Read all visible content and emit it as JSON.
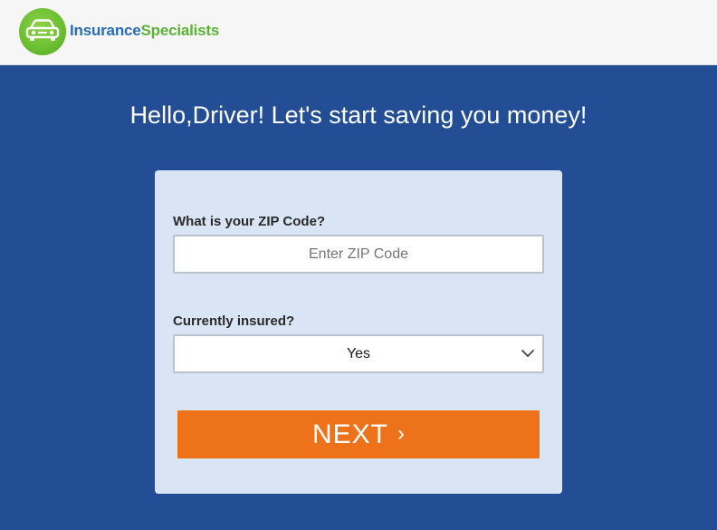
{
  "brand": {
    "name_part1": "Insurance",
    "name_part2": "Specialists",
    "logo_icon": "car-icon",
    "colors": {
      "blue": "#2b6cb8",
      "green": "#5db33a"
    }
  },
  "hero": {
    "title": "Hello,Driver! Let's start saving you money!",
    "background": "#234e96"
  },
  "form": {
    "zip_label": "What is your ZIP Code?",
    "zip_placeholder": "Enter ZIP Code",
    "zip_value": "",
    "insured_label": "Currently insured?",
    "insured_value": "Yes",
    "insured_icon": "chevron-down-icon",
    "next_label": "NEXT",
    "next_arrow": "›",
    "next_color": "#ed7219"
  }
}
